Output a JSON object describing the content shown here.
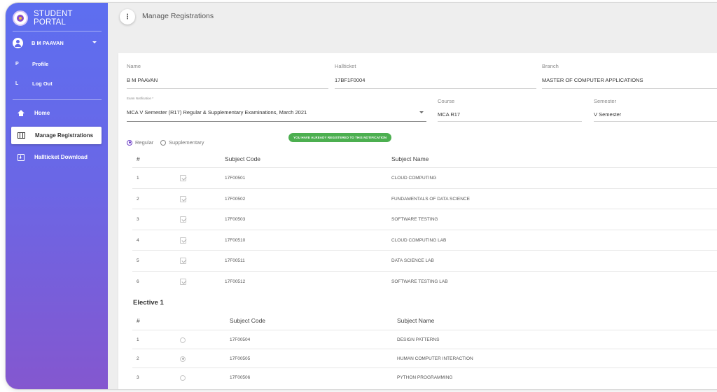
{
  "sidebar": {
    "brand": "STUDENT PORTAL",
    "user_name": "B M PAAVAN",
    "sub_items": [
      {
        "abbr": "P",
        "label": "Profile"
      },
      {
        "abbr": "L",
        "label": "Log Out"
      }
    ],
    "nav": [
      {
        "label": "Home",
        "icon": "home-icon"
      },
      {
        "label": "Manage Registrations",
        "icon": "grid-icon",
        "active": true
      },
      {
        "label": "Hallticket Download",
        "icon": "download-icon"
      }
    ]
  },
  "header": {
    "menu_icon": "⋮",
    "title": "Manage Registrations"
  },
  "form": {
    "name": {
      "label": "Name",
      "value": "B M PAAVAN"
    },
    "hallticket": {
      "label": "Hallticket",
      "value": "17BF1F0004"
    },
    "branch": {
      "label": "Branch",
      "value": "MASTER OF COMPUTER APPLICATIONS"
    },
    "exam_notification": {
      "label": "Exam Notification *",
      "value": "MCA V Semester (R17) Regular & Supplementary Examinations, March 2021"
    },
    "course": {
      "label": "Course",
      "value": "MCA R17"
    },
    "semester": {
      "label": "Semester",
      "value": "V Semester"
    }
  },
  "registration_type": {
    "regular": "Regular",
    "supplementary": "Supplementary",
    "selected": "Regular"
  },
  "status_badge": "YOU HAVE ALREADY REGISTERED TO THIS NOTIFICATION",
  "subjects_table": {
    "columns": {
      "num": "#",
      "code": "Subject Code",
      "name": "Subject Name"
    },
    "rows": [
      {
        "num": "1",
        "code": "17F00501",
        "name": "CLOUD COMPUTING",
        "checked": true
      },
      {
        "num": "2",
        "code": "17F00502",
        "name": "FUNDAMENTALS OF DATA SCIENCE",
        "checked": true
      },
      {
        "num": "3",
        "code": "17F00503",
        "name": "SOFTWARE TESTING",
        "checked": true
      },
      {
        "num": "4",
        "code": "17F00510",
        "name": "CLOUD COMPUTING LAB",
        "checked": true
      },
      {
        "num": "5",
        "code": "17F00511",
        "name": "DATA SCIENCE LAB",
        "checked": true
      },
      {
        "num": "6",
        "code": "17F00512",
        "name": "SOFTWARE TESTING LAB",
        "checked": true
      }
    ]
  },
  "elective": {
    "title": "Elective 1",
    "columns": {
      "num": "#",
      "code": "Subject Code",
      "name": "Subject Name"
    },
    "rows": [
      {
        "num": "1",
        "code": "17F00504",
        "name": "DESIGN PATTERNS",
        "selected": false
      },
      {
        "num": "2",
        "code": "17F00505",
        "name": "HUMAN COMPUTER INTERACTION",
        "selected": true
      },
      {
        "num": "3",
        "code": "17F00506",
        "name": "PYTHON PROGRAMMING",
        "selected": false
      }
    ]
  }
}
